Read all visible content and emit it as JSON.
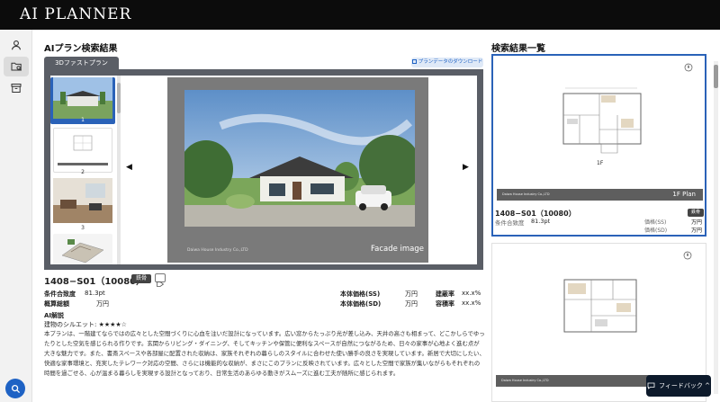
{
  "app": {
    "title": "AI PLANNER"
  },
  "sidebar": {
    "items": [
      "user-icon",
      "folder-search-icon",
      "archive-icon"
    ]
  },
  "main": {
    "title": "AIプラン検索結果",
    "tab_label": "3Dファストプラン",
    "download_label": "プランデータのダウンロード",
    "thumbnails": [
      {
        "num": "1",
        "active": true
      },
      {
        "num": "2",
        "active": false
      },
      {
        "num": "3",
        "active": false
      }
    ],
    "slide": {
      "brand_caption": "Daiwa House Industry Co.,LTD",
      "caption": "Facade image"
    },
    "plan": {
      "id": "1408−S01（10080）",
      "badge": "鉄骨",
      "rows": [
        {
          "label": "条件合致度",
          "value": "81.3pt",
          "label2": "本体価格(SS)",
          "value2": "万円",
          "label3": "建蔽率",
          "value3": "xx.x%"
        },
        {
          "label": "概算総額",
          "value": "万円",
          "label2": "本体価格(SD)",
          "value2": "万円",
          "label3": "容積率",
          "value3": "xx.x%"
        }
      ],
      "ai_heading": "AI解説",
      "silhouette_label": "建物のシルエット: ★★★★☆",
      "description": "本プランは、一階建てならではの広々とした空間づくりに心血を注いだ設計になっています。広い窓からたっぷり光が差し込み、天井の高さも相まって、どこかしらでゆったりとした空気を感じられる作りです。玄関からリビング・ダイニング、そしてキッチンや保管に便利なスペースが自然につながるため、日々の家事が心地よく進む点が大きな魅力です。また、書斎スペースや各部屋に配置された収納は、家族それぞれの暮らしのスタイルに合わせた使い勝手の良さを実現しています。新居で大切にしたい、快適な家事環境と、充実したテレワーク対応の空間、さらには機能的な収納が、まさにこのプランに反映されています。広々とした空間で家族が集いながらもそれぞれの時間を過ごせる、心が温まる暮らしを実現する設計となっており、日常生活のあらゆる動きがスムーズに進む工夫が随所に感じられます。"
    }
  },
  "results": {
    "title": "検索結果一覧",
    "cards": [
      {
        "floor_label": "1F",
        "plan_label": "1F Plan",
        "footer_brand": "Daiwa House Industry Co.,LTD",
        "id": "1408−S01（10080）",
        "badge": "鉄骨",
        "match_label": "条件合致度",
        "match_value": "81.3pt",
        "ss_label": "価格(SS)",
        "ss_value": "万円",
        "sd_label": "価格(SD)",
        "sd_value": "万円"
      },
      {
        "floor_label": "",
        "plan_label": "",
        "footer_brand": "Daiwa House Industry Co.,LTD"
      }
    ]
  },
  "feedback": {
    "label": "フィードバック ^"
  },
  "colors": {
    "accent": "#1e62c4",
    "topbar": "#0c0c0c",
    "viewer": "#5a5e66",
    "selected_border": "#2a62b8"
  }
}
